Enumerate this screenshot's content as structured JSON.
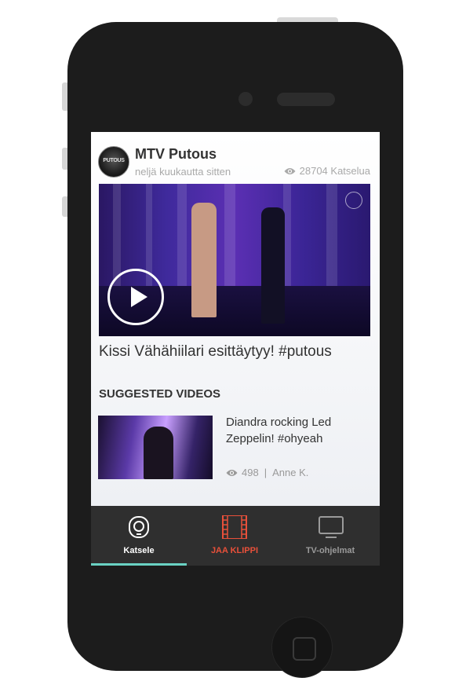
{
  "post": {
    "channel_name": "MTV Putous",
    "avatar_text": "PUTOUS",
    "posted_time": "neljä kuukautta sitten",
    "views": "28704 Katselua",
    "views_icon": "eye-icon",
    "video_title": "Kissi Vähähiilari esittäytyy! #putous",
    "play_icon": "play-icon"
  },
  "suggested": {
    "heading": "SUGGESTED VIDEOS",
    "items": [
      {
        "title": "Diandra rocking Led Zeppelin! #ohyeah",
        "views": "498",
        "separator": "|",
        "author": "Anne K."
      }
    ]
  },
  "tabbar": {
    "tabs": [
      {
        "label": "Katsele",
        "icon": "watch-icon",
        "color": "#ffffff",
        "active": true
      },
      {
        "label": "JAA KLIPPI",
        "icon": "film-icon",
        "color": "#e8503a",
        "active": false
      },
      {
        "label": "TV-ohjelmat",
        "icon": "tv-icon",
        "color": "#9a9a9a",
        "active": false
      }
    ],
    "active_indicator_color": "#6ad2c3"
  }
}
